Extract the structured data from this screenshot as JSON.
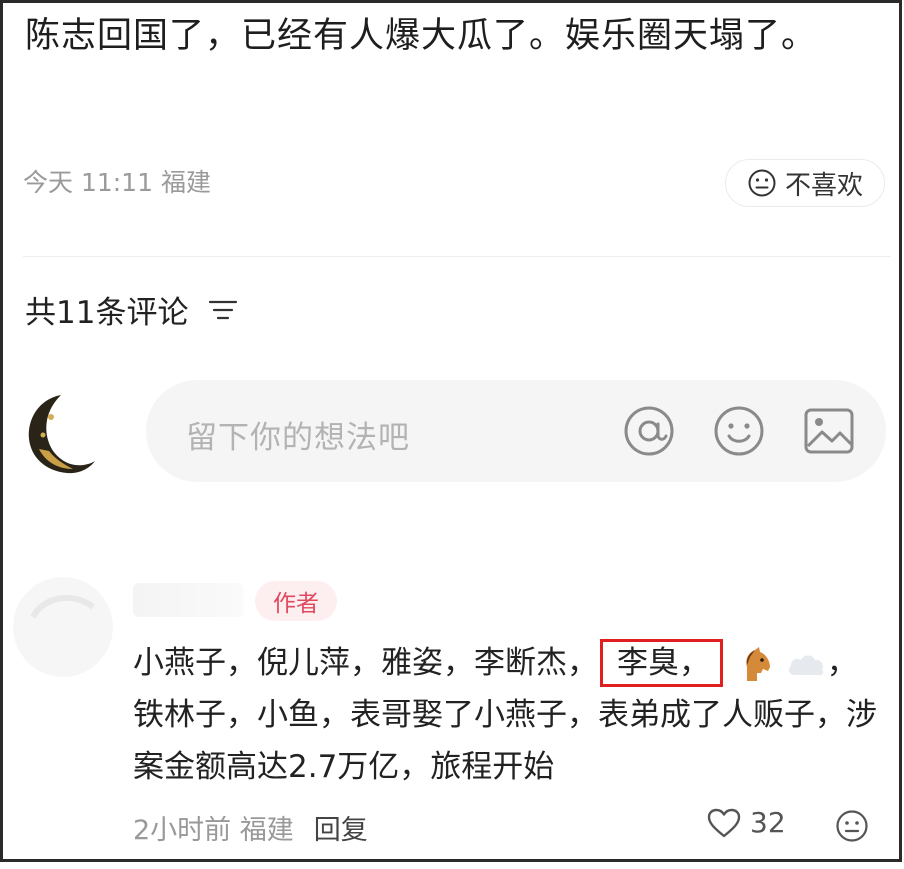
{
  "post": {
    "text": "陈志回国了，已经有人爆大瓜了。娱乐圈天塌了。",
    "meta": "今天 11:11 福建",
    "dislike_label": "不喜欢"
  },
  "comments_section": {
    "header": "共11条评论"
  },
  "comment_input": {
    "placeholder": "留下你的想法吧"
  },
  "comment": {
    "badge": "作者",
    "text_before": "小燕子，倪儿萍，雅姿，李断杰，",
    "highlighted": "李臭，",
    "text_after": "，铁林子，小鱼，表哥娶了小燕子，表弟成了人贩子，涉案金额高达2.7万亿，旅程开始",
    "time_location": "2小时前 福建",
    "reply_label": "回复",
    "like_count": "32"
  },
  "icons": {
    "dislike": "neutral-face-icon",
    "sort": "sort-lines-icon",
    "mention": "at-sign-icon",
    "emoji": "smile-icon",
    "image": "image-icon",
    "horse": "horse-emoji",
    "cloud": "cloud-emoji",
    "like": "heart-icon"
  },
  "colors": {
    "badge_text": "#e0495f",
    "badge_bg": "#fdeef0",
    "highlight_border": "#e02020",
    "placeholder": "#b3b3b3",
    "meta": "#999999"
  }
}
